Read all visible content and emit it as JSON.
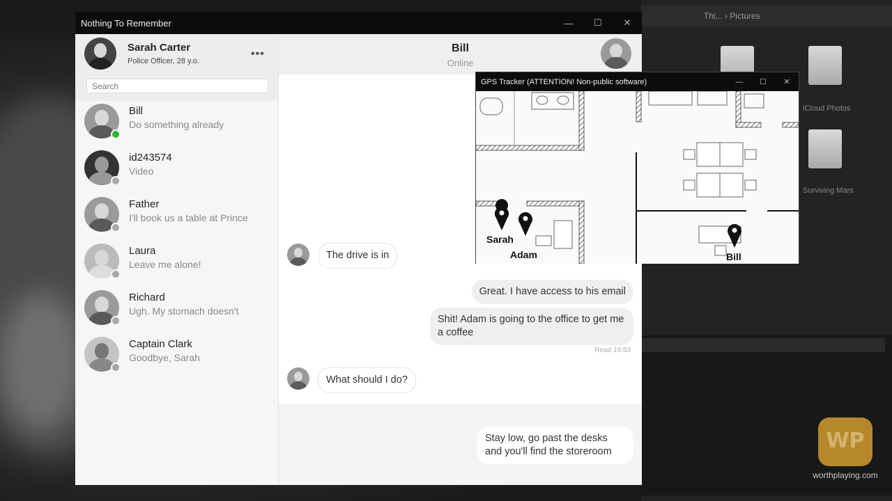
{
  "window": {
    "title": "Nothing To Remember"
  },
  "profile": {
    "name": "Sarah Carter",
    "subtitle": "Police Officer, 28 y.o.",
    "menu_label": "•••"
  },
  "search": {
    "placeholder": "Search"
  },
  "contacts": [
    {
      "name": "Bill",
      "last": "Do something already",
      "online": true
    },
    {
      "name": "id243574",
      "last": "Video",
      "online": false
    },
    {
      "name": "Father",
      "last": "I'll book us a table at Prince",
      "online": false
    },
    {
      "name": "Laura",
      "last": "Leave me alone!",
      "online": false
    },
    {
      "name": "Richard",
      "last": "Ugh. My stomach doesn't",
      "online": false
    },
    {
      "name": "Captain Clark",
      "last": "Goodbye, Sarah",
      "online": false
    }
  ],
  "chat": {
    "name": "Bill",
    "status": "Online",
    "messages": [
      {
        "dir": "in",
        "text": "The drive is in"
      },
      {
        "dir": "out",
        "text": "Great. I have access to his email"
      },
      {
        "dir": "out",
        "text": "Shit! Adam is going to the office to get me a coffee"
      },
      {
        "dir": "in",
        "text": "What should I do?"
      },
      {
        "dir": "out",
        "text": "Stay low, go past the desks and you'll find the storeroom"
      }
    ],
    "read_receipt": "Read 19:53"
  },
  "gps": {
    "title": "GPS Tracker (ATTENTION! Non-public software)",
    "pins": [
      "Sarah",
      "Adam",
      "Bill"
    ]
  },
  "background": {
    "explorer_path": "Thi... › Pictures",
    "folders": [
      "iCloud Photos",
      "Surviving Mars"
    ]
  },
  "watermark": {
    "logo": "WP",
    "text": "worthplaying.com"
  }
}
